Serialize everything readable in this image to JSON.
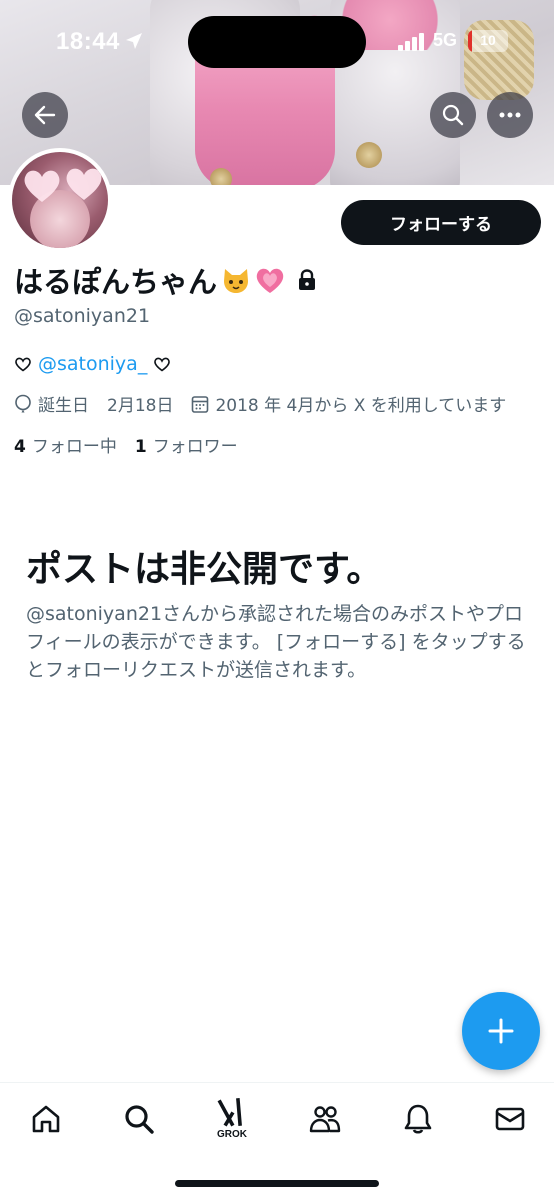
{
  "status_bar": {
    "time": "18:44",
    "network": "5G",
    "battery": "10"
  },
  "header": {
    "back_icon": "arrow-left-icon",
    "search_icon": "search-icon",
    "more_icon": "more-horizontal-icon"
  },
  "profile": {
    "display_name": "はるぽんちゃん",
    "name_emojis": [
      "cat-face-emoji",
      "growing-heart-emoji"
    ],
    "protected_icon": "lock-icon",
    "handle": "@satoniyan21",
    "follow_button": "フォローする",
    "bio": {
      "mention": "@satoniya_"
    },
    "birthday_label": "誕生日",
    "birthday": "2月18日",
    "joined": "2018 年 4月から X を利用しています",
    "following_count": "4",
    "following_label": "フォロー中",
    "followers_count": "1",
    "followers_label": "フォロワー"
  },
  "private_notice": {
    "title": "ポストは非公開です。",
    "description": "@satoniyan21さんから承認された場合のみポストやプロフィールの表示ができます。 [フォローする] をタップするとフォローリクエストが送信されます。"
  },
  "tabbar": {
    "items": [
      {
        "icon": "home-icon"
      },
      {
        "icon": "search-icon"
      },
      {
        "icon": "grok-icon",
        "label": "GROK"
      },
      {
        "icon": "communities-icon"
      },
      {
        "icon": "bell-icon"
      },
      {
        "icon": "mail-icon"
      }
    ]
  },
  "colors": {
    "accent": "#1d9bf0",
    "text": "#0f1419",
    "secondary": "#536471"
  }
}
